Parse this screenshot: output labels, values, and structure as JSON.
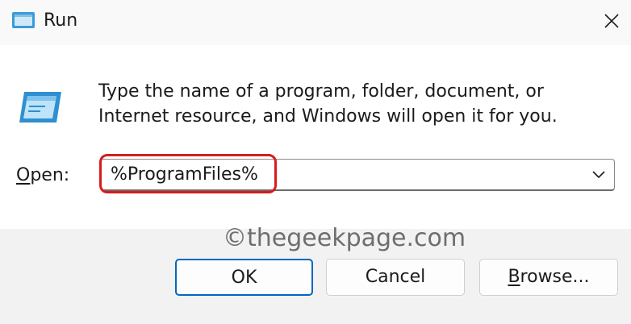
{
  "window": {
    "title": "Run",
    "icon": "run-icon",
    "close_icon": "close-icon"
  },
  "description": "Type the name of a program, folder, document, or Internet resource, and Windows will open it for you.",
  "open": {
    "label_mnemonic": "O",
    "label_rest": "pen:",
    "value": "%ProgramFiles%",
    "dropdown_icon": "chevron-down-icon"
  },
  "highlight_color": "#d81b1b",
  "watermark": "©thegeekpage.com",
  "buttons": {
    "ok": "OK",
    "cancel": "Cancel",
    "browse_mnemonic": "B",
    "browse_rest": "rowse..."
  },
  "colors": {
    "accent": "#0067c0",
    "footer": "#f2f2f2"
  }
}
